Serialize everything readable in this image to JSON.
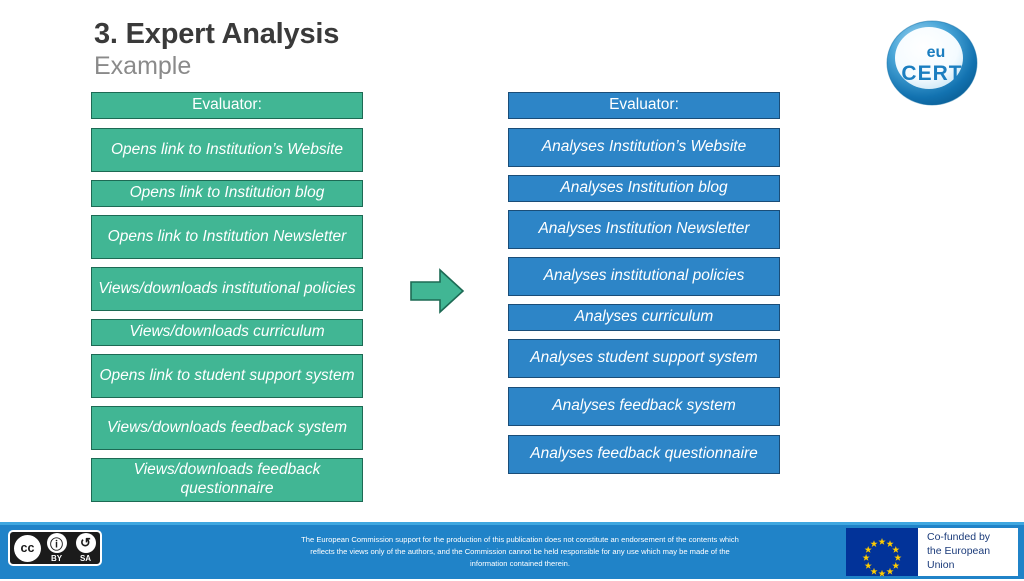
{
  "slide": {
    "title": "3. Expert Analysis",
    "subtitle": "Example"
  },
  "logo": {
    "name": "eu-cert-logo",
    "line1": "eu",
    "line2": "CERT"
  },
  "arrow": {
    "name": "right-arrow-icon",
    "direction": "right",
    "color": "#41b694"
  },
  "left_column": {
    "accent_color": "#41b694",
    "border_color": "#1d6a54",
    "header": "Evaluator:",
    "items": [
      "Opens link to Institution’s Website",
      "Opens link to Institution blog",
      "Opens link to Institution Newsletter",
      "Views/downloads institutional policies",
      "Views/downloads curriculum",
      "Opens link to student support system",
      "Views/downloads feedback system",
      "Views/downloads feedback questionnaire"
    ]
  },
  "right_column": {
    "accent_color": "#2d85c7",
    "border_color": "#1a4d78",
    "header": "Evaluator:",
    "items": [
      "Analyses Institution’s Website",
      "Analyses Institution blog",
      "Analyses Institution Newsletter",
      "Analyses institutional policies",
      "Analyses curriculum",
      "Analyses student support system",
      "Analyses feedback system",
      "Analyses feedback questionnaire"
    ]
  },
  "footer": {
    "background_color": "#2083c8",
    "license": {
      "name": "creative-commons-by-sa",
      "cc": "cc",
      "by_glyph": "ⓘ",
      "sa_glyph": "↺",
      "by_label": "BY",
      "sa_label": "SA"
    },
    "disclaimer": "The European Commission support for the production of this publication does not constitute an endorsement of the contents which reflects the views only of the authors, and the Commission cannot be held responsible for any use which may be made of the information contained therein.",
    "eu_funding": {
      "line1": "Co-funded by",
      "line2": "the European Union",
      "flag_color": "#023399",
      "star_color": "#ffcc00",
      "star_count": 12
    }
  }
}
